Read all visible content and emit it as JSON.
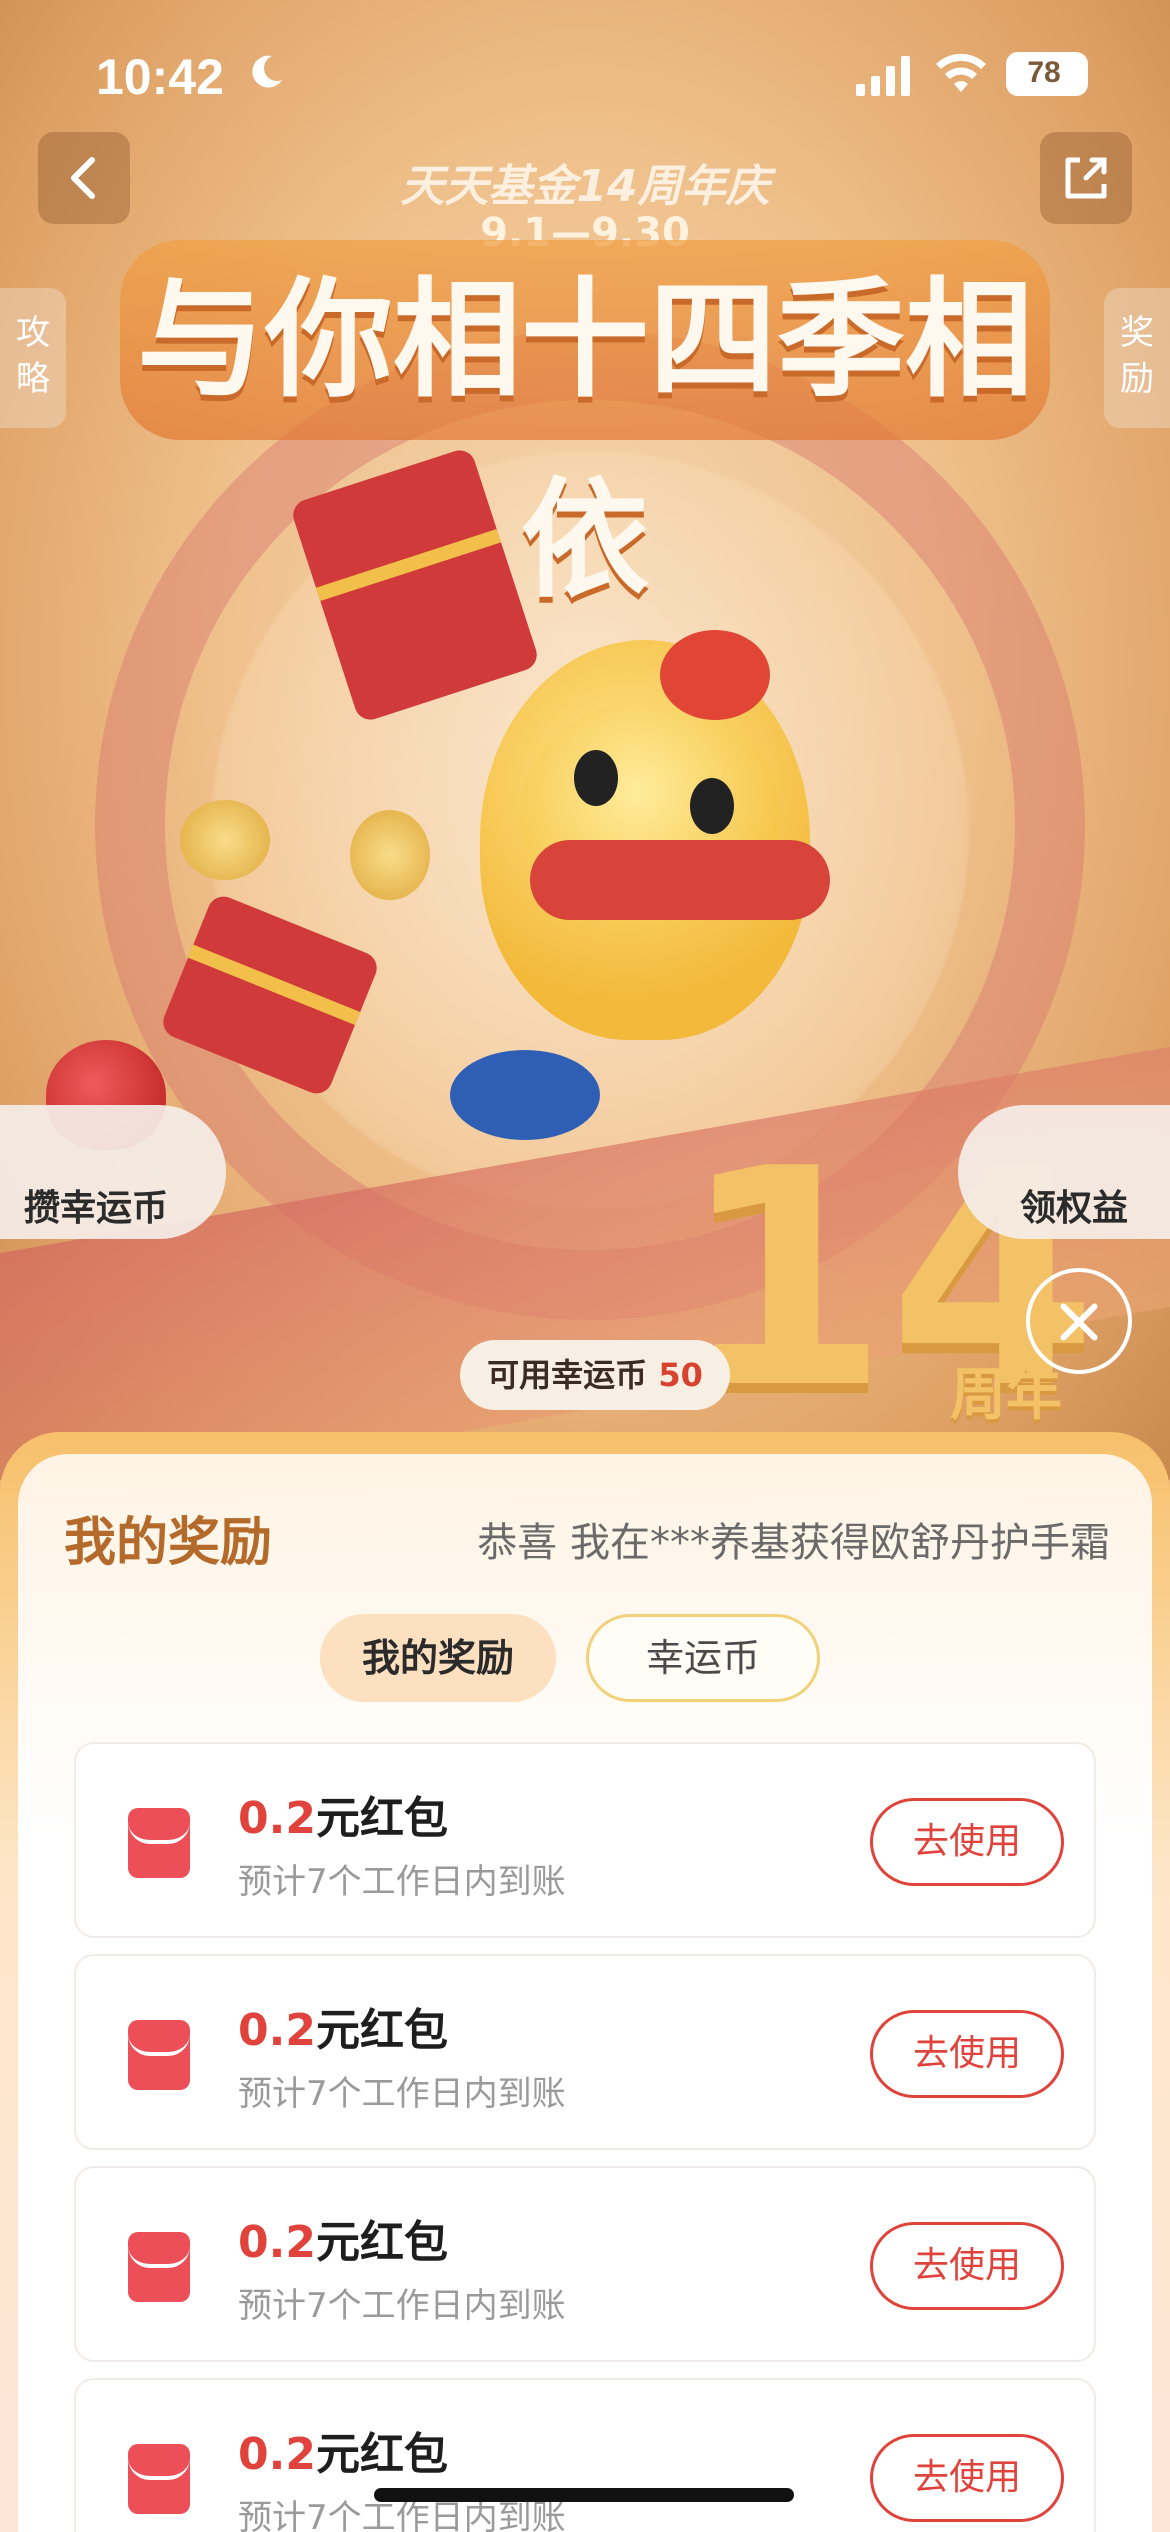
{
  "status_bar": {
    "time": "10:42",
    "battery": "78"
  },
  "hero": {
    "event_subtitle": "天天基金14周年庆",
    "event_dates": "9.1—9.30",
    "event_title": "与你相十四季相依",
    "left_tab": "攻略",
    "right_tab": "奖励",
    "float_left": "攒幸运币",
    "float_right": "领权益",
    "big_number": "14",
    "anniversary": "周年",
    "lucky_coins_label": "可用幸运币",
    "lucky_coins_value": "50"
  },
  "sheet": {
    "title": "我的奖励",
    "marquee": "恭喜 我在***养基获得欧舒丹护手霜",
    "tabs": [
      {
        "label": "我的奖励",
        "active": true
      },
      {
        "label": "幸运币",
        "active": false
      }
    ],
    "rewards": [
      {
        "amount": "0.2",
        "unit": "元红包",
        "desc": "预计7个工作日内到账",
        "action": "去使用"
      },
      {
        "amount": "0.2",
        "unit": "元红包",
        "desc": "预计7个工作日内到账",
        "action": "去使用"
      },
      {
        "amount": "0.2",
        "unit": "元红包",
        "desc": "预计7个工作日内到账",
        "action": "去使用"
      },
      {
        "amount": "0.2",
        "unit": "元红包",
        "desc": "预计7个工作日内到账",
        "action": "去使用"
      }
    ]
  },
  "colors": {
    "accent": "#e0433b",
    "title_brown": "#b46a2a",
    "tab_active_bg": "#fde0c0"
  }
}
